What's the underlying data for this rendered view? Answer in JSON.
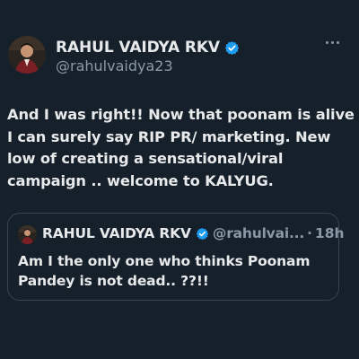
{
  "colors": {
    "background": "#15202b",
    "text_primary": "#e7e9ea",
    "text_secondary": "#8b98a5",
    "verified_blue": "#1d9bf0",
    "border": "#38444d"
  },
  "tweet": {
    "author_name": "RAHUL VAIDYA RKV",
    "author_handle": "@rahulvaidya23",
    "verified": true,
    "more_icon": "more-horizontal-icon",
    "text_lines": [
      "And I was right!! Now that poonam is alive",
      "I can surely say RIP PR/ marketing. New",
      "low of creating a sensational/viral",
      "campaign .. welcome to KALYUG."
    ]
  },
  "quoted_tweet": {
    "author_name": "RAHUL VAIDYA RKV",
    "author_handle": "@rahulvai...",
    "separator": "·",
    "time": "18h",
    "verified": true,
    "text_lines": [
      "Am I the only one who thinks Poonam",
      "Pandey is not dead.. ??!!"
    ]
  }
}
